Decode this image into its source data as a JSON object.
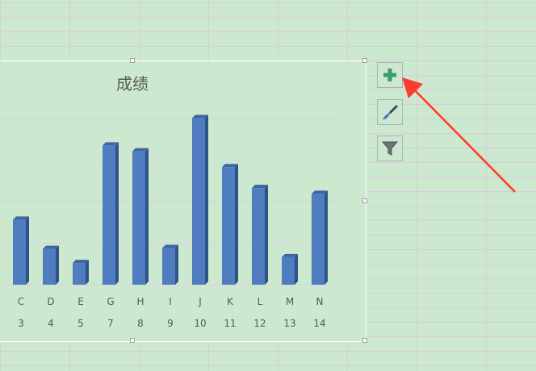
{
  "chart_data": {
    "type": "bar",
    "title": "成绩",
    "categories": [
      "C",
      "D",
      "E",
      "G",
      "H",
      "I",
      "J",
      "K",
      "L",
      "M",
      "N"
    ],
    "secondary_labels": [
      "3",
      "4",
      "5",
      "7",
      "8",
      "9",
      "10",
      "11",
      "12",
      "13",
      "14"
    ],
    "values": [
      78,
      43,
      26,
      167,
      160,
      44,
      200,
      141,
      116,
      33,
      109
    ],
    "ylim": [
      0,
      210
    ],
    "bar_color": "#4f7dc0",
    "grid": true
  },
  "side_buttons": {
    "chart_elements": "chart-elements-plus-icon",
    "chart_styles": "paintbrush-icon",
    "chart_filters": "filter-icon"
  },
  "colors": {
    "sheet_background": "#cce8cf",
    "arrow": "#ff3b2f",
    "plus": "#3c9d6a"
  }
}
